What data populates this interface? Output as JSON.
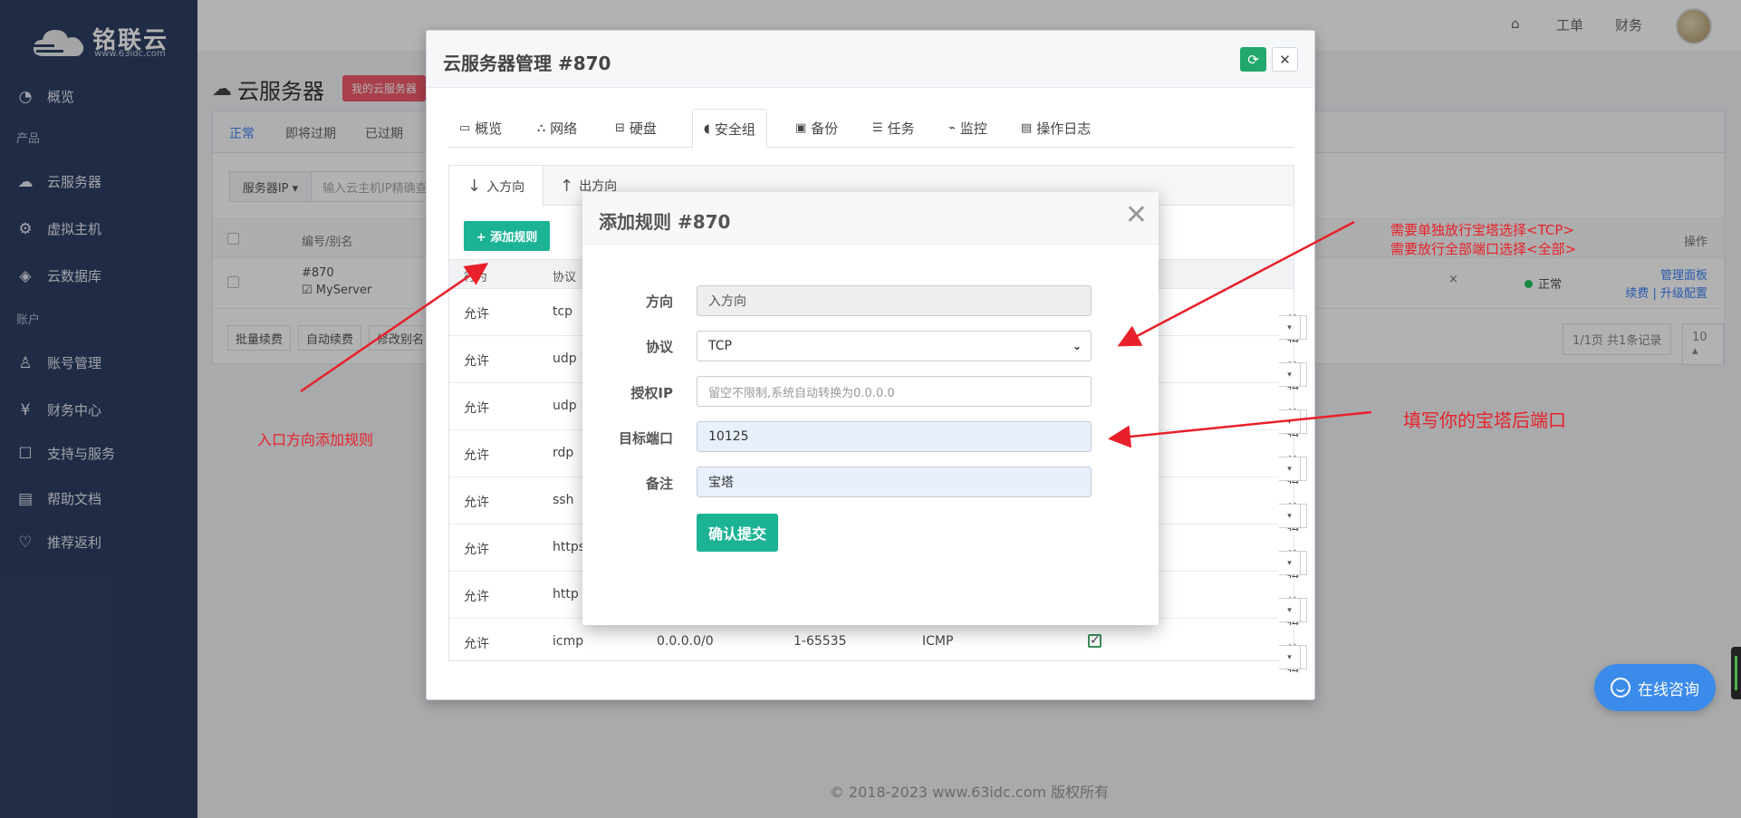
{
  "brand": {
    "name": "铭联云",
    "sub": "www.63idc.com"
  },
  "sidebar": {
    "items": [
      {
        "label": "概览",
        "icon": "dashboard-icon"
      },
      {
        "section": "产品"
      },
      {
        "label": "云服务器",
        "icon": "cloud-icon"
      },
      {
        "label": "虚拟主机",
        "icon": "gear-icon"
      },
      {
        "label": "云数据库",
        "icon": "layers-icon"
      },
      {
        "section": "账户"
      },
      {
        "label": "账号管理",
        "icon": "user-icon"
      },
      {
        "label": "财务中心",
        "icon": "yen-icon"
      },
      {
        "label": "支持与服务",
        "icon": "chat-icon"
      },
      {
        "label": "帮助文档",
        "icon": "doc-icon"
      },
      {
        "label": "推荐返利",
        "icon": "heart-icon"
      }
    ]
  },
  "topbar": {
    "home": "⌂",
    "ticket": "工单",
    "finance": "财务"
  },
  "page": {
    "title": "云服务器",
    "badge": "我的云服务器",
    "tabs": [
      "正常",
      "即将过期",
      "已过期"
    ],
    "search": {
      "select": "服务器IP ▾",
      "placeholder": "输入云主机IP精确查询"
    },
    "columns": {
      "id": "编号/别名",
      "ops": "操作"
    },
    "row": {
      "id": "#870",
      "alias": "☑ MyServer",
      "status": "正常",
      "x": "×",
      "manage": "管理面板",
      "actions": "续费 | 升级配置"
    },
    "footer": {
      "renew": "批量续费",
      "auto": "自动续费",
      "rename": "修改别名",
      "pages": "1/1页 共1条记录",
      "size": "10 ▴"
    },
    "copyright": "© 2018-2023 www.63idc.com 版权所有"
  },
  "server_modal": {
    "title": "云服务器管理 #870",
    "refresh_icon": "⟳",
    "close_icon": "✕",
    "tabs": [
      {
        "icon": "▭",
        "label": "概览"
      },
      {
        "icon": "⛬",
        "label": "网络"
      },
      {
        "icon": "⊟",
        "label": "硬盘"
      },
      {
        "icon": "◖",
        "label": "安全组"
      },
      {
        "icon": "▣",
        "label": "备份"
      },
      {
        "icon": "☰",
        "label": "任务"
      },
      {
        "icon": "⌁",
        "label": "监控"
      },
      {
        "icon": "▤",
        "label": "操作日志"
      }
    ],
    "subtabs": {
      "inbound": "入方向",
      "outbound": "出方向"
    },
    "add_rule": "+ 添加规则",
    "columns": {
      "action": "行为",
      "protocol": "协议"
    },
    "rules": [
      {
        "action": "允许",
        "protocol": "tcp"
      },
      {
        "action": "允许",
        "protocol": "udp"
      },
      {
        "action": "允许",
        "protocol": "udp"
      },
      {
        "action": "允许",
        "protocol": "rdp"
      },
      {
        "action": "允许",
        "protocol": "ssh"
      },
      {
        "action": "允许",
        "protocol": "https"
      },
      {
        "action": "允许",
        "protocol": "http"
      },
      {
        "action": "允许",
        "protocol": "icmp",
        "ip": "0.0.0.0/0",
        "port": "1-65535",
        "type": "ICMP",
        "checked": "✓"
      }
    ],
    "edit_label": "编辑",
    "dropdown_caret": "▾"
  },
  "add_rule_modal": {
    "title": "添加规则 #870",
    "close_icon": "✕",
    "fields": {
      "direction": {
        "label": "方向",
        "value": "入方向"
      },
      "protocol": {
        "label": "协议",
        "value": "TCP",
        "caret": "⌄"
      },
      "auth_ip": {
        "label": "授权IP",
        "placeholder": "留空不限制,系统自动转换为0.0.0.0"
      },
      "target_port": {
        "label": "目标端口",
        "value": "10125"
      },
      "remark": {
        "label": "备注",
        "value": "宝塔"
      }
    },
    "submit": "确认提交"
  },
  "annotations": {
    "left_note": "入口方向添加规则",
    "right_note_1": "需要单独放行宝塔选择<TCP>",
    "right_note_2": "需要放行全部端口选择<全部>",
    "port_note": "填写你的宝塔后端口",
    "color": "#e8202a"
  },
  "chat": {
    "label": "在线咨询"
  }
}
